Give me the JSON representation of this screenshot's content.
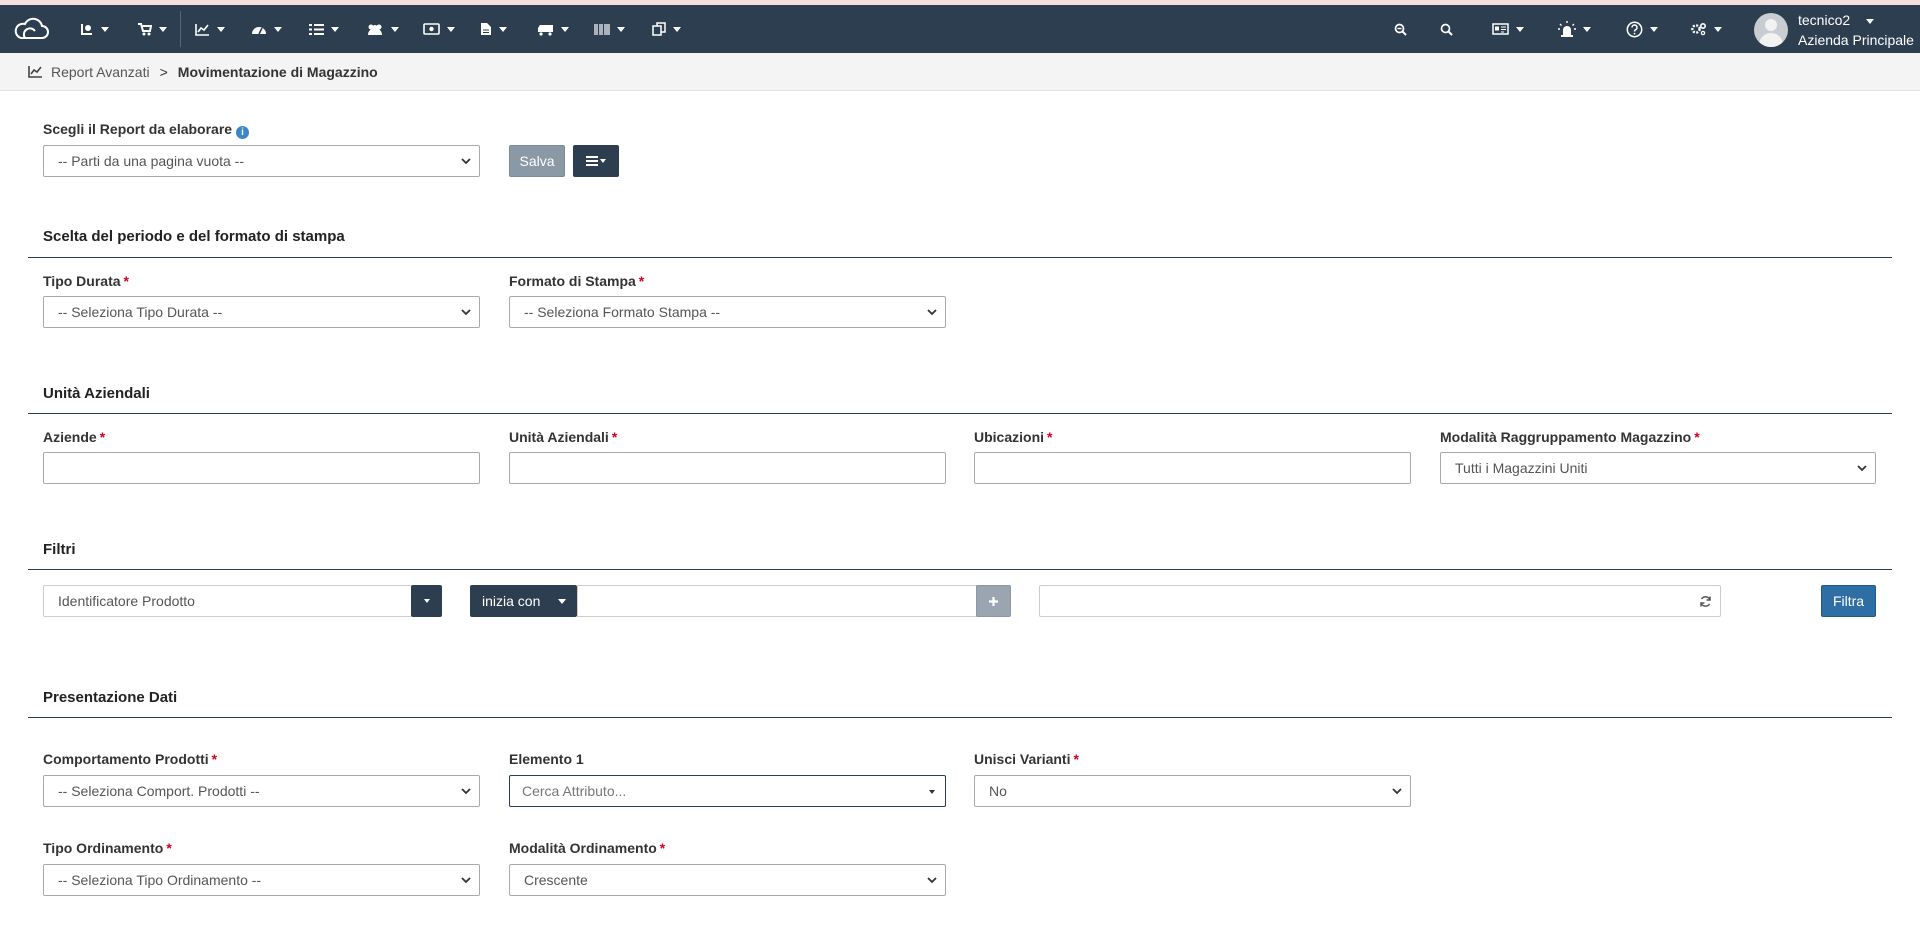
{
  "navbar": {
    "user_name": "tecnico2",
    "company": "Azienda Principale",
    "icons": [
      "cloud-logo",
      "hand-coins-icon",
      "cart-icon",
      "chart-icon",
      "dashboard-icon",
      "list-icon",
      "users-icon",
      "money-icon",
      "file-icon",
      "truck-icon",
      "barcode-icon",
      "clone-icon",
      "search-minus-icon",
      "search-icon",
      "id-card-icon",
      "alarm-icon",
      "help-icon",
      "settings-icon"
    ]
  },
  "breadcrumb": {
    "parent": "Report Avanzati",
    "separator": ">",
    "current": "Movimentazione di Magazzino"
  },
  "report": {
    "label": "Scegli il Report da elaborare",
    "select_value": "-- Parti da una pagina vuota --",
    "save_label": "Salva"
  },
  "period": {
    "title": "Scelta del periodo e del formato di stampa",
    "duration_label": "Tipo Durata",
    "duration_value": "-- Seleziona Tipo Durata --",
    "format_label": "Formato di Stampa",
    "format_value": "-- Seleziona Formato Stampa --"
  },
  "units": {
    "title": "Unità Aziendali",
    "companies_label": "Aziende",
    "units_label": "Unità Aziendali",
    "locations_label": "Ubicazioni",
    "grouping_label": "Modalità Raggruppamento Magazzino",
    "grouping_value": "Tutti i Magazzini Uniti"
  },
  "filters": {
    "title": "Filtri",
    "field_value": "Identificatore Prodotto",
    "operator_label": "inizia con",
    "filter_button": "Filtra"
  },
  "presentation": {
    "title": "Presentazione Dati",
    "behavior_label": "Comportamento Prodotti",
    "behavior_value": "-- Seleziona Comport. Prodotti --",
    "element_label": "Elemento 1",
    "element_placeholder": "Cerca Attributo...",
    "merge_label": "Unisci Varianti",
    "merge_value": "No",
    "sort_type_label": "Tipo Ordinamento",
    "sort_type_value": "-- Seleziona Tipo Ordinamento --",
    "sort_mode_label": "Modalità Ordinamento",
    "sort_mode_value": "Crescente"
  },
  "colors": {
    "navbar": "#2d3e50",
    "primary_button": "#2f6ea5",
    "required": "#d0021b"
  }
}
